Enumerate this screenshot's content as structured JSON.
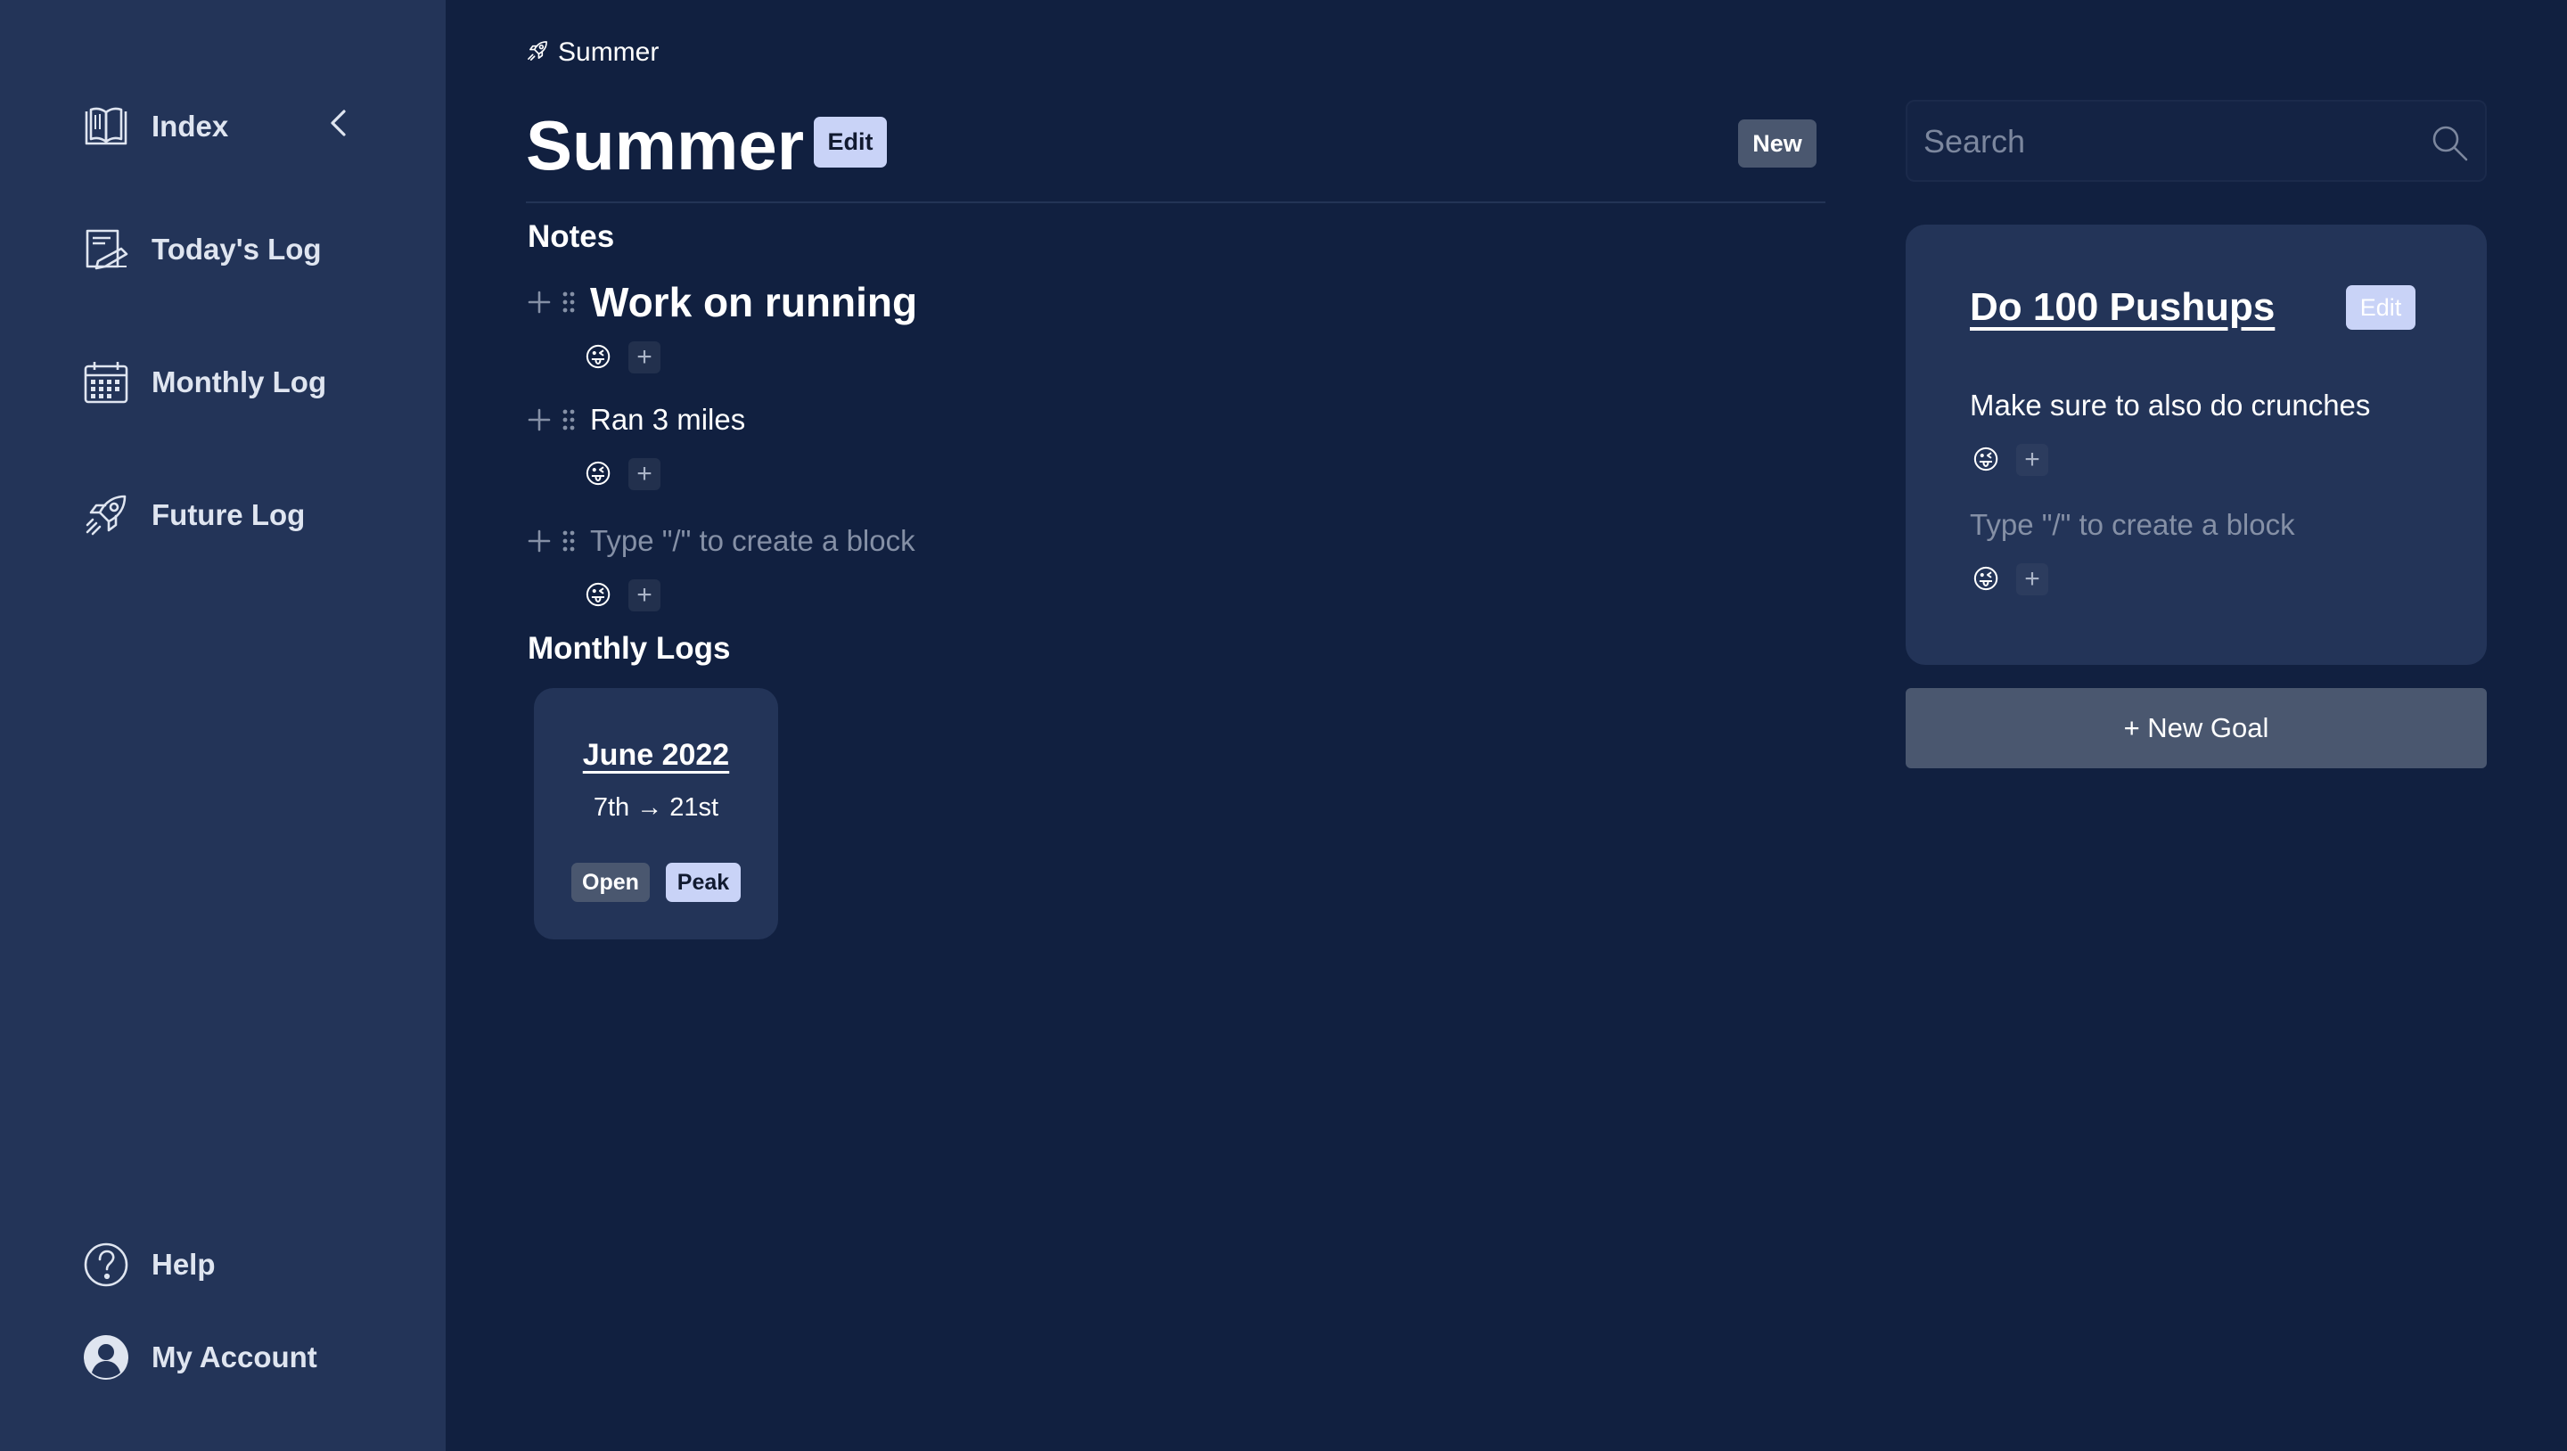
{
  "sidebar": {
    "items": [
      {
        "label": "Index",
        "icon": "book-icon"
      },
      {
        "label": "Today's Log",
        "icon": "notebook-pen-icon"
      },
      {
        "label": "Monthly Log",
        "icon": "calendar-icon"
      },
      {
        "label": "Future Log",
        "icon": "rocket-icon"
      }
    ],
    "bottom": [
      {
        "label": "Help",
        "icon": "help-circle-icon"
      },
      {
        "label": "My Account",
        "icon": "user-circle-icon"
      }
    ]
  },
  "breadcrumb": {
    "label": "Summer"
  },
  "page": {
    "title": "Summer",
    "edit_label": "Edit",
    "new_label": "New"
  },
  "notes": {
    "heading": "Notes",
    "blocks": [
      {
        "text": "Work on running",
        "style": "heading",
        "emoji": "😜"
      },
      {
        "text": "Ran 3 miles",
        "style": "paragraph",
        "emoji": "😜"
      }
    ],
    "placeholder": "Type \"/\" to create a block",
    "placeholder_emoji": "😜"
  },
  "monthly_logs": {
    "heading": "Monthly Logs",
    "cards": [
      {
        "title": "June 2022",
        "range": "7th → 21st",
        "open_label": "Open",
        "peak_label": "Peak"
      }
    ]
  },
  "search": {
    "placeholder": "Search"
  },
  "goal": {
    "title": "Do 100 Pushups",
    "edit_label": "Edit",
    "text": "Make sure to also do crunches",
    "emoji": "😜",
    "placeholder": "Type \"/\" to create a block",
    "placeholder_emoji": "😜"
  },
  "new_goal_label": "+ New Goal",
  "colors": {
    "background": "#112040",
    "sidebar": "#233458",
    "accent_light": "#c9d3f7",
    "button_gray": "#4a576f"
  }
}
